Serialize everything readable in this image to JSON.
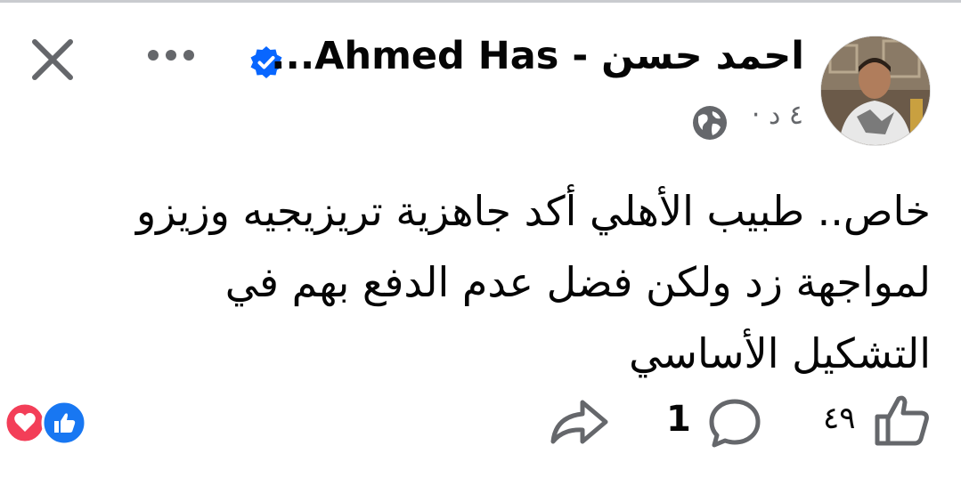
{
  "header": {
    "author_name": "احمد حسن - Ahmed Has...",
    "time": "٤ د ·",
    "avatar_alt": "profile photo"
  },
  "post": {
    "text": "خاص.. طبيب الأهلي أكد جاهزية تريزيجيه وزيزو لمواجهة زد ولكن فضل عدم الدفع بهم في التشكيل الأساسي"
  },
  "footer": {
    "like_count": "٤٩",
    "comment_count": "1"
  },
  "colors": {
    "verified_blue": "#0866ff",
    "like_blue": "#1877f2",
    "love_red": "#f33e58",
    "icon_gray": "#65676b",
    "text": "#050505"
  }
}
